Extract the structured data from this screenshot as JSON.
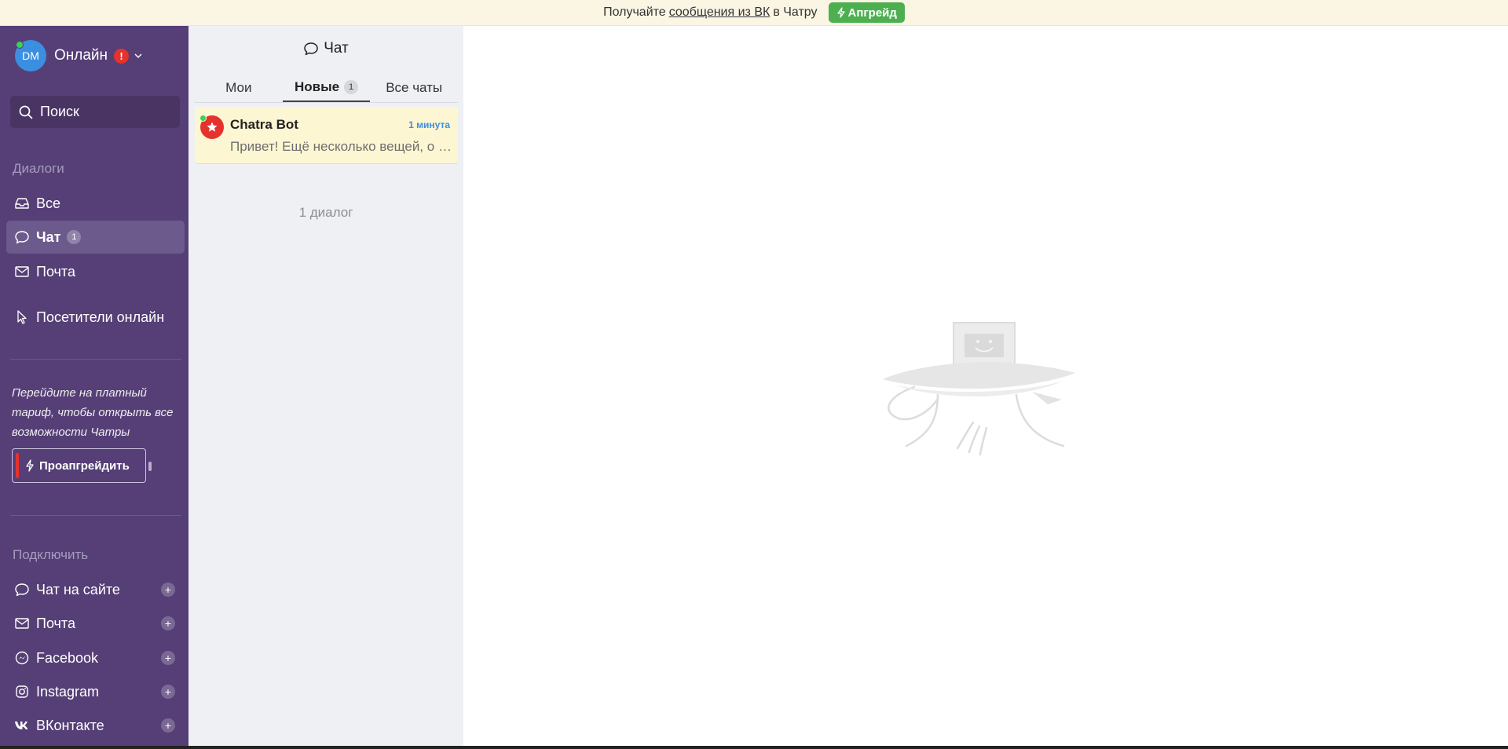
{
  "banner": {
    "text_before": "Получайте",
    "link": "сообщения из ВК",
    "text_after": "в Чатру",
    "button": "Апгрейд"
  },
  "sidebar": {
    "avatar_initials": "DM",
    "status": "Онлайн",
    "alert": "!",
    "search_placeholder": "Поиск",
    "dialogs_title": "Диалоги",
    "dialogs": [
      {
        "label": "Все",
        "icon": "inbox-icon"
      },
      {
        "label": "Чат",
        "icon": "chat-bubble-icon",
        "count": "1",
        "active": true
      },
      {
        "label": "Почта",
        "icon": "envelope-icon"
      }
    ],
    "visitors_label": "Посетители онлайн",
    "promo_text": "Перейдите на платный тариф, чтобы открыть все возможности Чатры",
    "promo_button": "Проапгрейдить",
    "connect_title": "Подключить",
    "connect": [
      {
        "label": "Чат на сайте",
        "icon": "chat-bubble-icon"
      },
      {
        "label": "Почта",
        "icon": "envelope-icon"
      },
      {
        "label": "Facebook",
        "icon": "messenger-icon"
      },
      {
        "label": "Instagram",
        "icon": "instagram-icon"
      },
      {
        "label": "ВКонтакте",
        "icon": "vk-icon"
      }
    ],
    "plus": "+"
  },
  "list": {
    "title": "Чат",
    "tabs": [
      {
        "label": "Мои"
      },
      {
        "label": "Новые",
        "count": "1",
        "active": true
      },
      {
        "label": "Все чаты"
      }
    ],
    "conversation": {
      "name": "Chatra Bot",
      "time": "1 минута",
      "preview": "Привет! Ещё несколько вещей, о которых стоит знать"
    },
    "dialog_count": "1 диалог"
  },
  "colors": {
    "sidebar": "#553f76",
    "banner": "#fbf5e4",
    "upgrade_green": "#4caf50",
    "accent_red": "#e5322d",
    "time_blue": "#3b8fe0"
  }
}
